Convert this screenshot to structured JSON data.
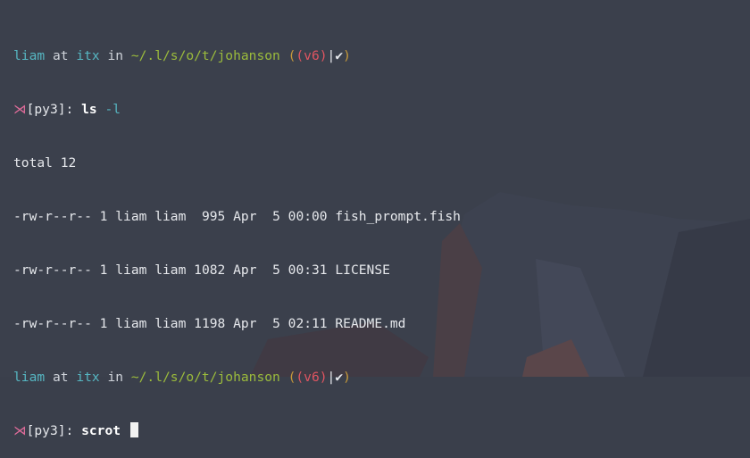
{
  "colors": {
    "background": "#3a3f4b",
    "user": "#56b6c2",
    "path": "#9bbb3c",
    "venv": "#e05561",
    "parens": "#c79a3a",
    "fish_icon": "#e06c9a"
  },
  "icons": {
    "fish": "fish-icon",
    "check": "checkmark-icon"
  },
  "prompt1": {
    "user": "liam",
    "at": "at",
    "host": "itx",
    "in": "in",
    "path": "~/.l/s/o/t/johanson",
    "paren_open": "(",
    "venv": "(v6)",
    "pipe": "|",
    "check": "✔",
    "paren_close": ")",
    "fish": "⋊",
    "env": "[py3]:",
    "cmd": "ls",
    "flag": "-l"
  },
  "output": {
    "total": "total 12",
    "files": [
      {
        "perms": "-rw-r--r--",
        "links": "1",
        "owner": "liam",
        "group": "liam",
        "size": " 995",
        "month": "Apr",
        "day": " 5",
        "time": "00:00",
        "name": "fish_prompt.fish"
      },
      {
        "perms": "-rw-r--r--",
        "links": "1",
        "owner": "liam",
        "group": "liam",
        "size": "1082",
        "month": "Apr",
        "day": " 5",
        "time": "00:31",
        "name": "LICENSE"
      },
      {
        "perms": "-rw-r--r--",
        "links": "1",
        "owner": "liam",
        "group": "liam",
        "size": "1198",
        "month": "Apr",
        "day": " 5",
        "time": "02:11",
        "name": "README.md"
      }
    ]
  },
  "prompt2": {
    "user": "liam",
    "at": "at",
    "host": "itx",
    "in": "in",
    "path": "~/.l/s/o/t/johanson",
    "paren_open": "(",
    "venv": "(v6)",
    "pipe": "|",
    "check": "✔",
    "paren_close": ")",
    "fish": "⋊",
    "env": "[py3]:",
    "cmd": "scrot"
  }
}
